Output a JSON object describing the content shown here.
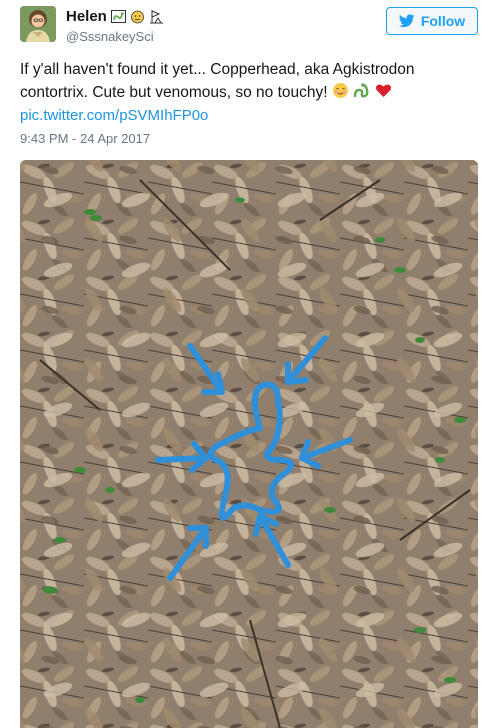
{
  "user": {
    "display_name": "Helen",
    "handle": "@SssnakeySci",
    "avatar_icon": "woman-avatar-icon",
    "name_emojis": [
      "snake-frame-icon",
      "face-icon",
      "flag-icon"
    ]
  },
  "follow_button": {
    "label": "Follow",
    "icon": "twitter-bird-icon"
  },
  "tweet": {
    "line1": "If y'all haven't found it yet... Copperhead, aka Agkistrodon",
    "line2": "contortrix. Cute but venomous, so no touchy!",
    "emojis": [
      "smiling-blush-icon",
      "snake-icon",
      "red-heart-icon"
    ],
    "link": "pic.twitter.com/pSVMIhFP0o",
    "timestamp": "9:43 PM - 24 Apr 2017"
  },
  "photo": {
    "subject": "leaf-litter-photo",
    "annotation": "blue-outline-arrows"
  },
  "colors": {
    "accent": "#1da1f2",
    "link": "#1b95e0",
    "muted": "#657786",
    "annotation_blue": "#2f8fd8"
  }
}
